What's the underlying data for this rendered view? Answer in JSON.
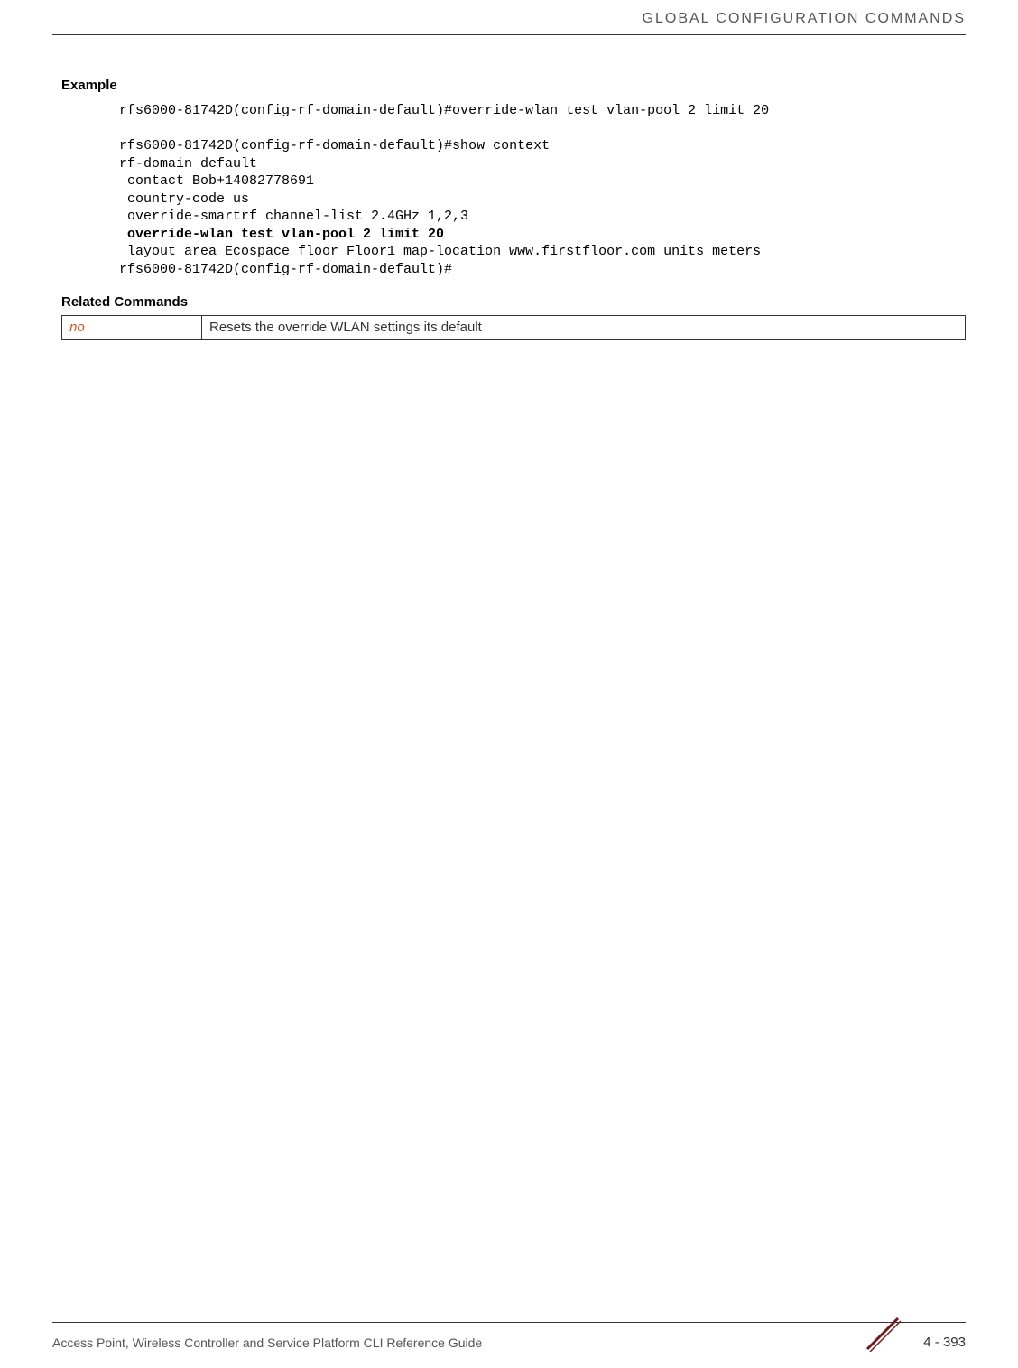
{
  "header": {
    "title": "GLOBAL CONFIGURATION COMMANDS"
  },
  "sections": {
    "example_heading": "Example",
    "code_line1": "rfs6000-81742D(config-rf-domain-default)#override-wlan test vlan-pool 2 limit 20",
    "code_line2": "rfs6000-81742D(config-rf-domain-default)#show context",
    "code_line3": "rf-domain default",
    "code_line4": " contact Bob+14082778691",
    "code_line5": " country-code us",
    "code_line6": " override-smartrf channel-list 2.4GHz 1,2,3",
    "code_line7_bold": " override-wlan test vlan-pool 2 limit 20",
    "code_line8": " layout area Ecospace floor Floor1 map-location www.firstfloor.com units meters",
    "code_line9": "rfs6000-81742D(config-rf-domain-default)#",
    "related_heading": "Related Commands",
    "related_cmd": "no",
    "related_desc": "Resets the override WLAN settings its default"
  },
  "footer": {
    "text": "Access Point, Wireless Controller and Service Platform CLI Reference Guide",
    "page": "4 - 393"
  }
}
